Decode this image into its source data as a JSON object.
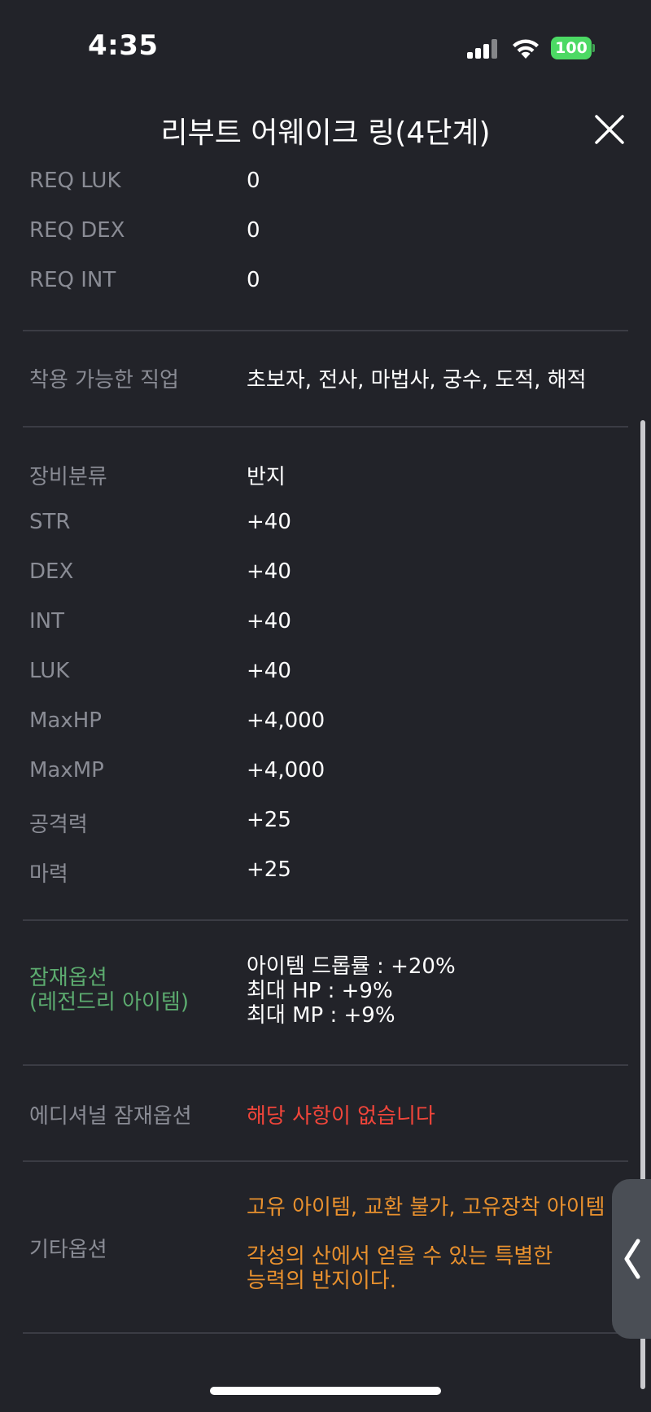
{
  "status_bar": {
    "time": "4:35",
    "battery": "100"
  },
  "header": {
    "title": "리부트 어웨이크 링(4단계)"
  },
  "requirements": [
    {
      "label": "REQ LUK",
      "value": "0"
    },
    {
      "label": "REQ DEX",
      "value": "0"
    },
    {
      "label": "REQ INT",
      "value": "0"
    }
  ],
  "jobs": {
    "label": "착용 가능한 직업",
    "value": "초보자, 전사, 마법사, 궁수, 도적, 해적"
  },
  "stats": [
    {
      "label": "장비분류",
      "value": "반지"
    },
    {
      "label": "STR",
      "value": "+40"
    },
    {
      "label": "DEX",
      "value": "+40"
    },
    {
      "label": "INT",
      "value": "+40"
    },
    {
      "label": "LUK",
      "value": "+40"
    },
    {
      "label": "MaxHP",
      "value": "+4,000"
    },
    {
      "label": "MaxMP",
      "value": "+4,000"
    },
    {
      "label": "공격력",
      "value": "+25"
    },
    {
      "label": "마력",
      "value": "+25"
    }
  ],
  "potential": {
    "label_line1": "잠재옵션",
    "label_line2": "(레전드리 아이템)",
    "lines": [
      "아이템 드롭률 : +20%",
      "최대 HP : +9%",
      "최대 MP : +9%"
    ],
    "color": "#5cab6f"
  },
  "additional": {
    "label": "에디셔널 잠재옵션",
    "value": "해당 사항이 없습니다",
    "color": "#f0453a"
  },
  "other": {
    "label": "기타옵션",
    "line1": "고유 아이템, 교환 불가, 고유장착 아이템",
    "line2": "각성의 산에서 얻을 수 있는 특별한",
    "line3": "능력의 반지이다.",
    "color": "#e9912e"
  }
}
